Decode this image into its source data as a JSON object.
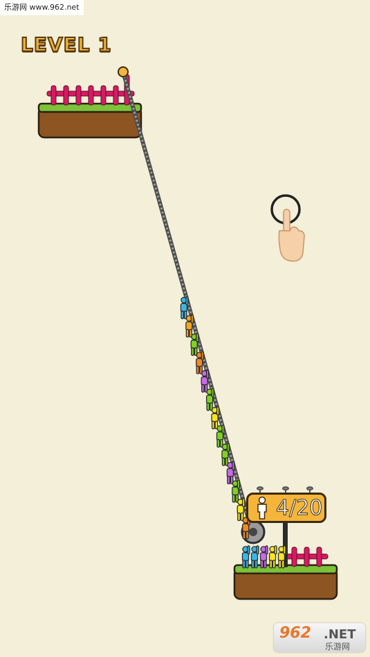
{
  "watermark_top": "乐游网 www.962.net",
  "level": {
    "title": "LEVEL 1"
  },
  "counter": {
    "text": "4/20",
    "icon": "person-icon"
  },
  "hint": {
    "icon": "tap-hand-icon"
  },
  "watermark_bottom": {
    "brand": "962",
    "net": ".NET",
    "cn": "乐游网"
  },
  "colors": {
    "background": "#f3efd9",
    "grass": "#7cc23a",
    "dirt": "#8d5522",
    "fence": "#d81b60",
    "rope": "#7d7d7d",
    "sign": "#f5b53a",
    "level_text": "#f0b43a"
  },
  "climber_colors": [
    "#39b8e8",
    "#f5a623",
    "#7ed321",
    "#f08a24",
    "#c86be8",
    "#7ed321",
    "#f8e71c",
    "#7ed321",
    "#7ed321",
    "#c86be8",
    "#7ed321",
    "#f8e71c",
    "#f08a24"
  ],
  "crowd_colors": [
    "#39b8e8",
    "#39b8e8",
    "#c86be8",
    "#f8e71c",
    "#f8e71c"
  ]
}
